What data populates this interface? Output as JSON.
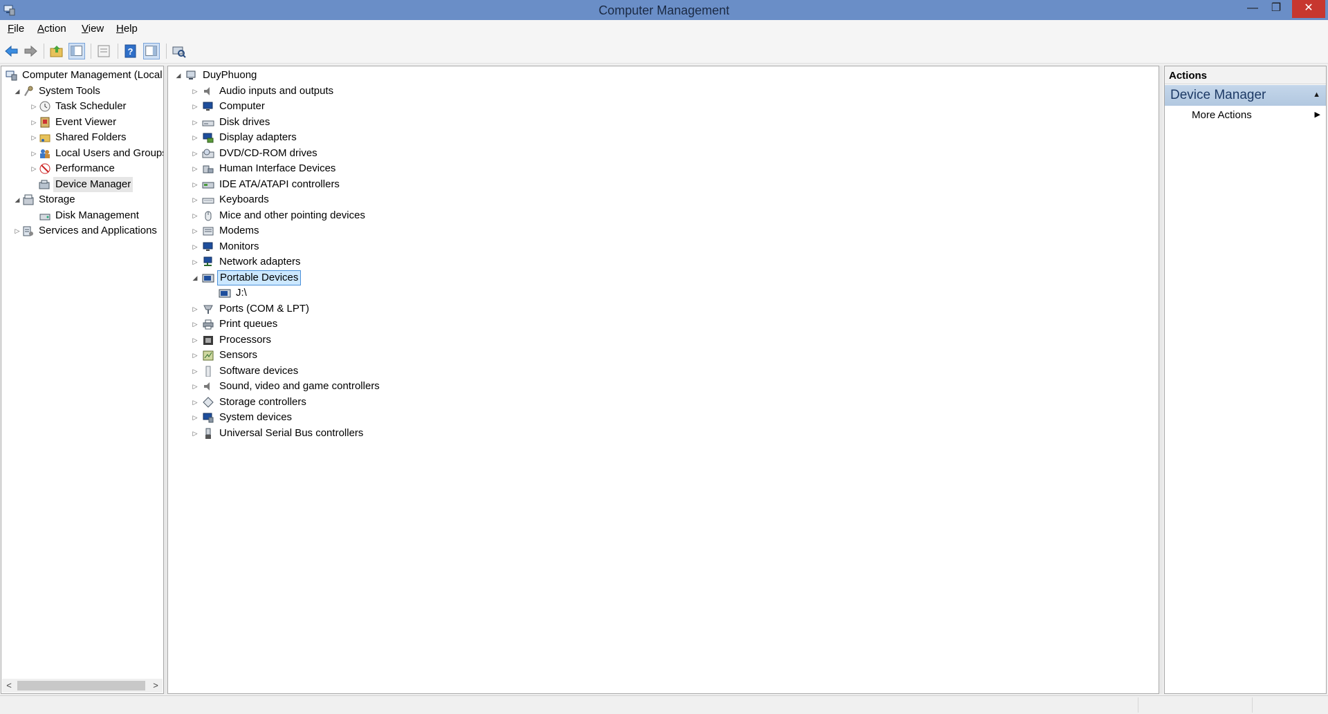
{
  "window": {
    "title": "Computer Management",
    "min_glyph": "—",
    "max_glyph": "❐",
    "close_glyph": "✕"
  },
  "menu": [
    {
      "key": "F",
      "rest": "ile"
    },
    {
      "key": "A",
      "rest": "ction"
    },
    {
      "key": "V",
      "rest": "iew"
    },
    {
      "key": "H",
      "rest": "elp"
    }
  ],
  "toolbar": {
    "icons": [
      "back-arrow-icon",
      "forward-arrow-icon",
      "up-folder-icon",
      "show-hide-console-tree-icon",
      "properties-icon",
      "help-icon",
      "show-hide-action-pane-icon",
      "scan-hardware-icon"
    ]
  },
  "left_tree": {
    "items": [
      {
        "label": "Computer Management (Local",
        "icon": "computer-management-icon",
        "expander": ""
      },
      {
        "label": "System Tools",
        "icon": "system-tools-icon",
        "expander": "◢"
      },
      {
        "label": "Task Scheduler",
        "icon": "clock-icon",
        "expander": "▷"
      },
      {
        "label": "Event Viewer",
        "icon": "event-viewer-icon",
        "expander": "▷"
      },
      {
        "label": "Shared Folders",
        "icon": "shared-folder-icon",
        "expander": "▷"
      },
      {
        "label": "Local Users and Groups",
        "icon": "users-icon",
        "expander": "▷"
      },
      {
        "label": "Performance",
        "icon": "performance-icon",
        "expander": "▷"
      },
      {
        "label": "Device Manager",
        "icon": "device-manager-icon",
        "expander": ""
      },
      {
        "label": "Storage",
        "icon": "storage-icon",
        "expander": "◢"
      },
      {
        "label": "Disk Management",
        "icon": "disk-management-icon",
        "expander": ""
      },
      {
        "label": "Services and Applications",
        "icon": "services-icon",
        "expander": "▷"
      }
    ],
    "scroll_left": "<",
    "scroll_right": ">"
  },
  "device_tree": {
    "root": {
      "label": "DuyPhuong",
      "icon": "computer-icon",
      "expander": "◢"
    },
    "categories": [
      {
        "label": "Audio inputs and outputs",
        "icon": "speaker-icon",
        "expander": "▷"
      },
      {
        "label": "Computer",
        "icon": "monitor-icon",
        "expander": "▷"
      },
      {
        "label": "Disk drives",
        "icon": "disk-drive-icon",
        "expander": "▷"
      },
      {
        "label": "Display adapters",
        "icon": "display-adapter-icon",
        "expander": "▷"
      },
      {
        "label": "DVD/CD-ROM drives",
        "icon": "dvd-drive-icon",
        "expander": "▷"
      },
      {
        "label": "Human Interface Devices",
        "icon": "hid-icon",
        "expander": "▷"
      },
      {
        "label": "IDE ATA/ATAPI controllers",
        "icon": "ide-controller-icon",
        "expander": "▷"
      },
      {
        "label": "Keyboards",
        "icon": "keyboard-icon",
        "expander": "▷"
      },
      {
        "label": "Mice and other pointing devices",
        "icon": "mouse-icon",
        "expander": "▷"
      },
      {
        "label": "Modems",
        "icon": "modem-icon",
        "expander": "▷"
      },
      {
        "label": "Monitors",
        "icon": "monitor-icon",
        "expander": "▷"
      },
      {
        "label": "Network adapters",
        "icon": "network-adapter-icon",
        "expander": "▷"
      },
      {
        "label": "Portable Devices",
        "icon": "portable-device-icon",
        "expander": "◢"
      },
      {
        "label": "J:\\",
        "icon": "portable-device-icon",
        "expander": ""
      },
      {
        "label": "Ports (COM & LPT)",
        "icon": "port-icon",
        "expander": "▷"
      },
      {
        "label": "Print queues",
        "icon": "printer-icon",
        "expander": "▷"
      },
      {
        "label": "Processors",
        "icon": "processor-icon",
        "expander": "▷"
      },
      {
        "label": "Sensors",
        "icon": "sensor-icon",
        "expander": "▷"
      },
      {
        "label": "Software devices",
        "icon": "software-device-icon",
        "expander": "▷"
      },
      {
        "label": "Sound, video and game controllers",
        "icon": "speaker-icon",
        "expander": "▷"
      },
      {
        "label": "Storage controllers",
        "icon": "storage-controller-icon",
        "expander": "▷"
      },
      {
        "label": "System devices",
        "icon": "system-device-icon",
        "expander": "▷"
      },
      {
        "label": "Universal Serial Bus controllers",
        "icon": "usb-icon",
        "expander": "▷"
      }
    ]
  },
  "actions": {
    "header": "Actions",
    "section": "Device Manager",
    "section_glyph": "▲",
    "item": "More Actions",
    "item_glyph": "▶"
  },
  "colors": {
    "titlebar": "#6a8ec7",
    "close_button": "#c7372f",
    "selection": "#cce8ff",
    "actions_section": "#b8cce4"
  }
}
